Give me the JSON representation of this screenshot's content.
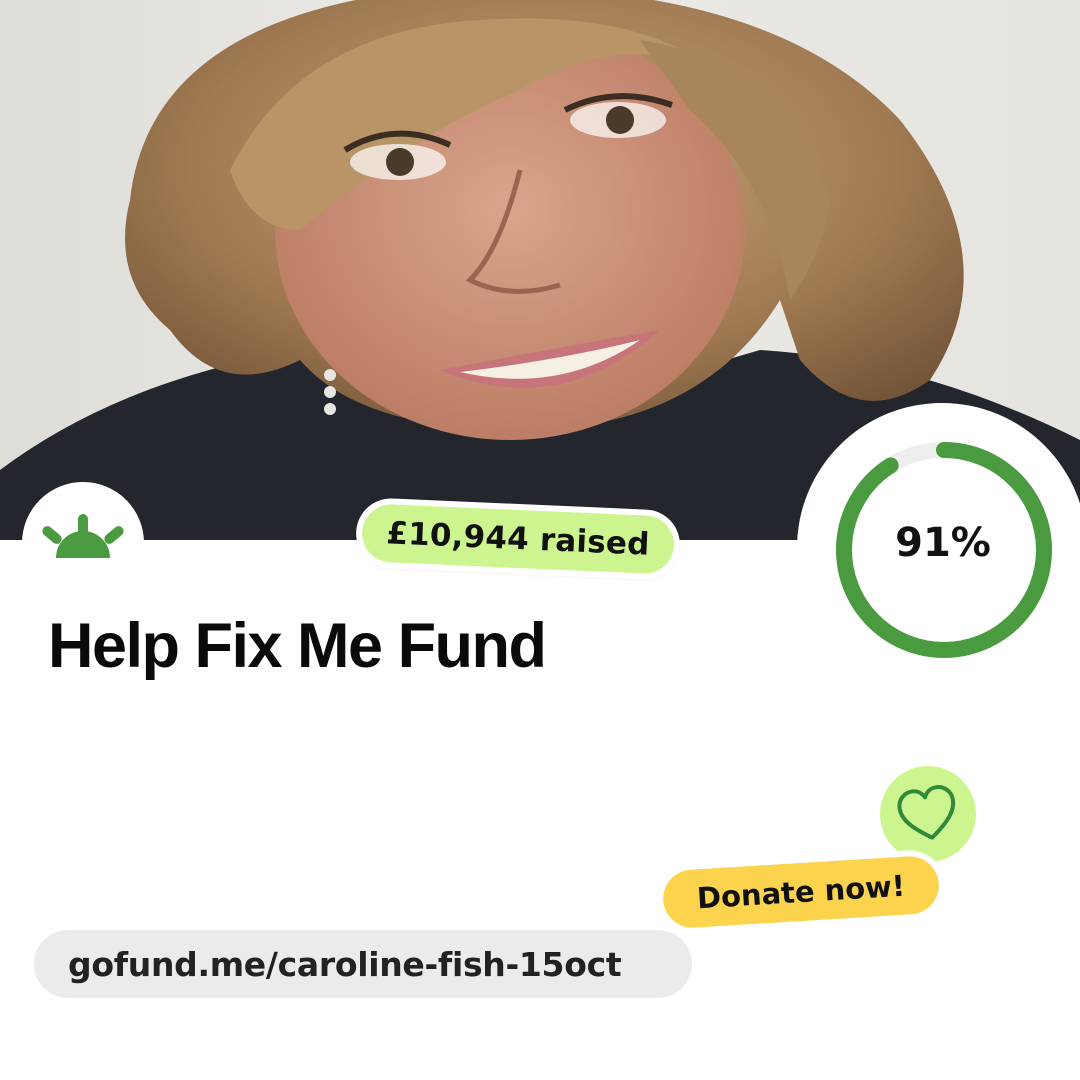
{
  "campaign": {
    "title": "Help Fix Me Fund",
    "raised_label": "£10,944 raised",
    "progress_label": "91%",
    "progress_fraction": 0.91,
    "donate_label": "Donate now!",
    "url": "gofund.me/caroline-fish-15oct"
  },
  "colors": {
    "brand_green": "#4a9a3f",
    "lime": "#cdf58f",
    "donate_yellow": "#fcd34d",
    "url_pill_bg": "#ebebeb"
  },
  "icons": {
    "logo": "gofundme-sunrise-icon",
    "heart": "heart-outline-icon"
  }
}
